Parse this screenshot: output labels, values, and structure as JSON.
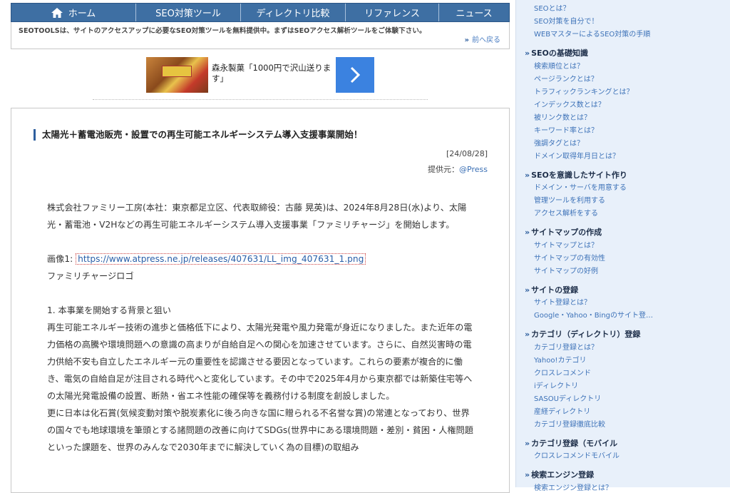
{
  "nav": {
    "items": [
      "ホーム",
      "SEO対策ツール",
      "ディレクトリ比較",
      "リファレンス",
      "ニュース"
    ]
  },
  "tagline": "SEOTOOLSは、サイトのアクセスアップに必要なSEO対策ツールを無料提供中。まずはSEOアクセス解析ツールをご体験下さい。",
  "back_link": "前へ戻る",
  "ad": {
    "text": "森永製菓「1000円で沢山送ります」",
    "button_icon": "chevron-right-icon"
  },
  "article": {
    "title": "太陽光＋蓄電池販売・設置での再生可能エネルギーシステム導入支援事業開始！",
    "date": "[24/08/28]",
    "provider_label": "提供元：",
    "provider_link": "@Press",
    "para1": "株式会社ファミリー工房(本社：東京都足立区、代表取締役：古藤 晃英)は、2024年8月28日(水)より、太陽光・蓄電池・V2Hなどの再生可能エネルギーシステム導入支援事業「ファミリチャージ」を開始します。",
    "image_label": "画像1: ",
    "image_url": "https://www.atpress.ne.jp/releases/407631/LL_img_407631_1.png",
    "image_caption": "ファミリチャージロゴ",
    "section1_title": "1. 本事業を開始する背景と狙い",
    "para2": "再生可能エネルギー技術の進歩と価格低下により、太陽光発電や風力発電が身近になりました。また近年の電力価格の高騰や環境問題への意識の高まりが自給自足への関心を加速させています。さらに、自然災害時の電力供給不安も自立したエネルギー元の重要性を認識させる要因となっています。これらの要素が複合的に働き、電気の自給自足が注目される時代へと変化しています。その中で2025年4月から東京都では新築住宅等への太陽光発電設備の設置、断熱・省エネ性能の確保等を義務付ける制度を創設しました。",
    "para3": "更に日本は化石賞(気候変動対策や脱炭素化に後ろ向きな国に贈られる不名誉な賞)の常連となっており、世界の国々でも地球環境を筆頭とする諸問題の改善に向けてSDGs(世界中にある環境問題・差別・貧困・人権問題といった課題を、世界のみんなで2030年までに解決していく為の目標)の取組み"
  },
  "sidebar": {
    "top_items": [
      "SEOとは？",
      "SEO対策を自分で！",
      "WEBマスターによるSEO対策の手順"
    ],
    "sections": [
      {
        "title": "SEOの基礎知識",
        "items": [
          "検索順位とは？",
          "ページランクとは？",
          "トラフィックランキングとは？",
          "インデックス数とは？",
          "被リンク数とは？",
          "キーワード率とは？",
          "強調タグとは？",
          "ドメイン取得年月日とは？"
        ]
      },
      {
        "title": "SEOを意識したサイト作り",
        "items": [
          "ドメイン・サーバを用意する",
          "管理ツールを利用する",
          "アクセス解析をする"
        ]
      },
      {
        "title": "サイトマップの作成",
        "items": [
          "サイトマップとは？",
          "サイトマップの有効性",
          "サイトマップの好例"
        ]
      },
      {
        "title": "サイトの登録",
        "items": [
          "サイト登録とは？",
          "Google・Yahoo・Bingのサイト登…"
        ]
      },
      {
        "title": "カテゴリ（ディレクトリ）登録",
        "items": [
          "カテゴリ登録とは？",
          "Yahoo!カテゴリ",
          "クロスレコメンド",
          "iディレクトリ",
          "SASOUディレクトリ",
          "産経ディレクトリ",
          "カテゴリ登録徹底比較"
        ]
      },
      {
        "title": "カテゴリ登録（モバイル",
        "items": [
          "クロスレコメンドモバイル"
        ]
      },
      {
        "title": "検索エンジン登録",
        "items": [
          "検索エンジン登録とは？"
        ]
      }
    ]
  }
}
